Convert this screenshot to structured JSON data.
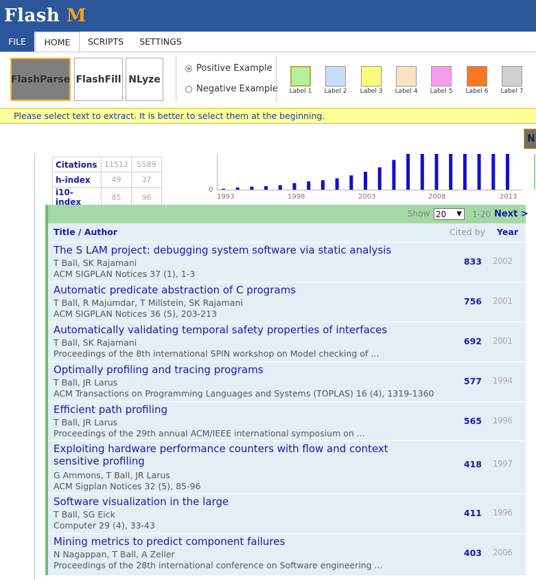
{
  "app": {
    "title_a": "Flash ",
    "title_b": "M"
  },
  "tabs": {
    "file": "FILE",
    "home": "HOME",
    "scripts": "SCRIPTS",
    "settings": "SETTINGS"
  },
  "ribbon": {
    "buttons": [
      "FlashParse",
      "FlashFill",
      "NLyze"
    ],
    "positive_label": "Positive Example",
    "negative_label": "Negative Example",
    "labels": [
      {
        "name": "Label 1",
        "color": "#b3f29a"
      },
      {
        "name": "Label 2",
        "color": "#c6dcf7"
      },
      {
        "name": "Label 3",
        "color": "#f9fb7a"
      },
      {
        "name": "Label 4",
        "color": "#fde1c2"
      },
      {
        "name": "Label 5",
        "color": "#f79af0"
      },
      {
        "name": "Label 6",
        "color": "#f77a20"
      },
      {
        "name": "Label 7",
        "color": "#cfcfcf"
      }
    ]
  },
  "message": "Please select text to extract. It is better to select them at the beginning.",
  "n_button": "N",
  "stats": {
    "rows": [
      {
        "label": "Citations",
        "all": "11512",
        "since": "5589"
      },
      {
        "label": "h-index",
        "all": "49",
        "since": "37"
      },
      {
        "label": "i10-index",
        "all": "85",
        "since": "96"
      }
    ]
  },
  "chart_data": {
    "type": "bar",
    "x_ticks": [
      "1993",
      "1998",
      "2003",
      "2008",
      "2013"
    ],
    "y_tick": "0",
    "years": [
      1993,
      1994,
      1995,
      1996,
      1997,
      1998,
      1999,
      2000,
      2001,
      2002,
      2003,
      2004,
      2005,
      2006,
      2007,
      2008,
      2009,
      2010,
      2011,
      2012,
      2013
    ],
    "values": [
      3,
      7,
      10,
      12,
      15,
      22,
      28,
      32,
      38,
      48,
      60,
      75,
      100,
      120,
      120,
      120,
      120,
      120,
      120,
      120,
      120
    ],
    "color": "#1010cc"
  },
  "list": {
    "show_label": "Show",
    "show_value": "20",
    "range": "1-20",
    "next": "Next >",
    "col_title": "Title / Author",
    "col_cited": "Cited by",
    "col_year": "Year",
    "rows": [
      {
        "title": "The S LAM project: debugging system software via static analysis",
        "authors": "T Ball, SK Rajamani",
        "venue": "ACM SIGPLAN Notices 37 (1), 1-3",
        "cites": "833",
        "year": "2002"
      },
      {
        "title": "Automatic predicate abstraction of C programs",
        "authors": "T Ball, R Majumdar, T Millstein, SK Rajamani",
        "venue": "ACM SIGPLAN Notices 36 (5), 203-213",
        "cites": "756",
        "year": "2001"
      },
      {
        "title": "Automatically validating temporal safety properties of interfaces",
        "authors": "T Ball, SK Rajamani",
        "venue": "Proceedings of the 8th international SPIN workshop on Model checking of ...",
        "cites": "692",
        "year": "2001"
      },
      {
        "title": "Optimally profiling and tracing programs",
        "authors": "T Ball, JR Larus",
        "venue": "ACM Transactions on Programming Languages and Systems (TOPLAS) 16 (4), 1319-1360",
        "cites": "577",
        "year": "1994"
      },
      {
        "title": "Efficient path profiling",
        "authors": "T Ball, JR Larus",
        "venue": "Proceedings of the 29th annual ACM/IEEE international symposium on ...",
        "cites": "565",
        "year": "1996"
      },
      {
        "title": "Exploiting hardware performance counters with flow and context sensitive profiling",
        "authors": "G Ammons, T Ball, JR Larus",
        "venue": "ACM Sigplan Notices 32 (5), 85-96",
        "cites": "418",
        "year": "1997"
      },
      {
        "title": "Software visualization in the large",
        "authors": "T Ball, SG Eick",
        "venue": "Computer 29 (4), 33-43",
        "cites": "411",
        "year": "1996"
      },
      {
        "title": "Mining metrics to predict component failures",
        "authors": "N Nagappan, T Ball, A Zeller",
        "venue": "Proceedings of the 28th international conference on Software engineering ...",
        "cites": "403",
        "year": "2006"
      }
    ]
  }
}
